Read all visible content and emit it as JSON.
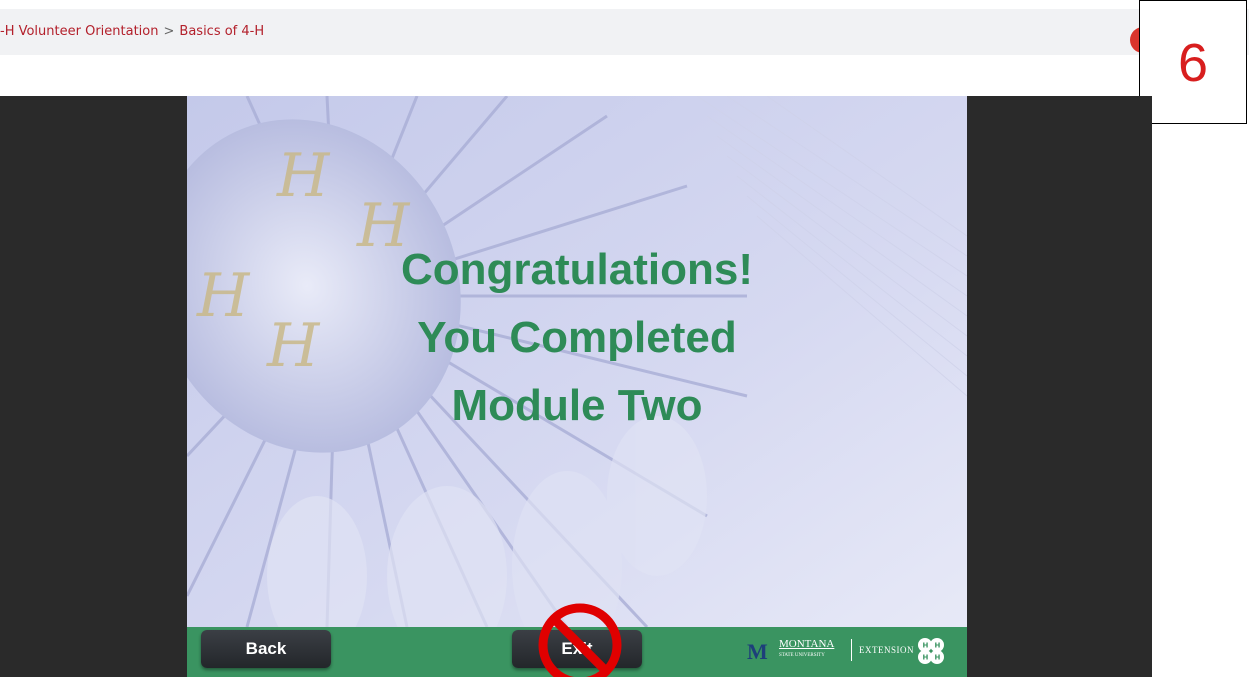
{
  "header": {
    "breadcrumb": [
      "-H Volunteer Orientation",
      "Basics of 4-H"
    ],
    "separator": ">"
  },
  "step_label": "6",
  "slide": {
    "headline": [
      "Congratulations!",
      "You Completed",
      "Module Two"
    ]
  },
  "footer": {
    "back_label": "Back",
    "exit_label": "Exit",
    "logo": {
      "mark": "M",
      "name_line1": "MONTANA",
      "name_line2": "STATE UNIVERSITY",
      "extension": "EXTENSION"
    }
  },
  "colors": {
    "accent_red": "#b3202b",
    "headline_green": "#2e8b57",
    "footer_green": "#3a9461",
    "prohibit_red": "#e00000"
  },
  "icons": [
    "prohibition-icon",
    "four-h-clover-icon",
    "montana-m-logo"
  ]
}
